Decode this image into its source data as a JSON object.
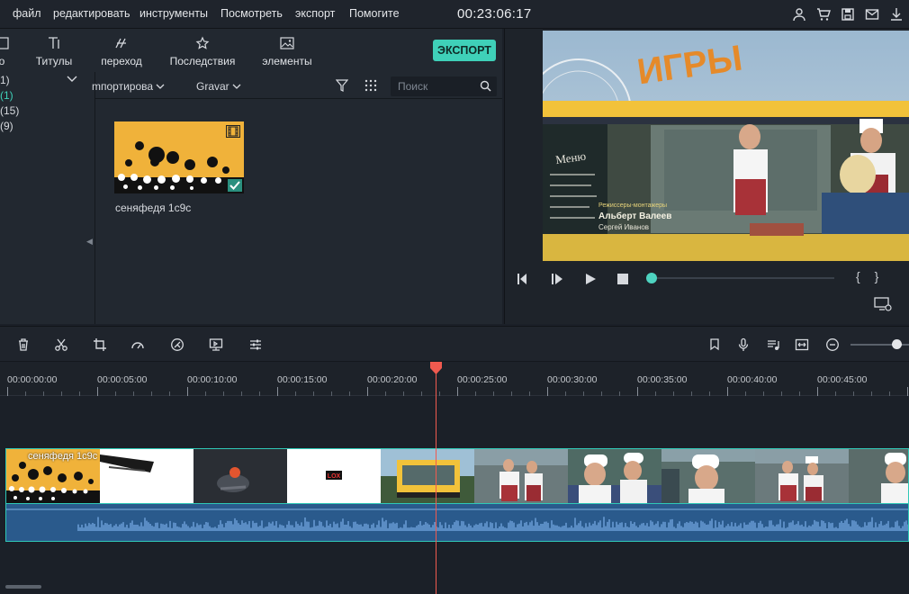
{
  "menu": {
    "items": [
      "файл",
      "редактировать",
      "инструменты",
      "Посмотреть",
      "экспорт",
      "Помогите"
    ],
    "timecode": "00:23:06:17"
  },
  "top_icons": [
    "user-icon",
    "cart-icon",
    "save-icon",
    "mail-icon",
    "download-icon"
  ],
  "library": {
    "tabs": [
      {
        "label": "о",
        "icon": "media-icon"
      },
      {
        "label": "Титулы",
        "icon": "titles-icon"
      },
      {
        "label": "переход",
        "icon": "transition-icon"
      },
      {
        "label": "Последствия",
        "icon": "effects-icon"
      },
      {
        "label": "элементы",
        "icon": "elements-icon"
      }
    ],
    "export_label": "ЭКСПОРТ",
    "sidebar": [
      {
        "label": "1)",
        "active": false
      },
      {
        "label": "(1)",
        "active": true
      },
      {
        "label": " (15)",
        "active": false
      },
      {
        "label": "(9)",
        "active": false
      }
    ],
    "filter": {
      "import_label": "mпортирова",
      "sort_label": "Gravar",
      "search_placeholder": "Поиск"
    },
    "clip": {
      "name": "сеняфедя 1с9с"
    }
  },
  "preview": {
    "overlay_line1": "Режиссеры-монтажеры",
    "overlay_line2": "Альберт Валеев",
    "overlay_line3": "Сергей Иванов",
    "sign_text": "ИГРЫ",
    "menu_board": "Меню",
    "progress": 0.0,
    "braces": "{ }"
  },
  "toolbar": {
    "left_icons": [
      "delete-icon",
      "cut-icon",
      "crop-icon",
      "speed-icon",
      "color-icon",
      "screen-icon",
      "adjust-icon"
    ],
    "right_icons": [
      "marker-icon",
      "mic-icon",
      "audio-mixer-icon",
      "fit-icon",
      "zoom-out-icon"
    ],
    "zoom_level": 0.8
  },
  "timeline": {
    "ruler": [
      "00:00:00:00",
      "00:00:05:00",
      "00:00:10:00",
      "00:00:15:00",
      "00:00:20:00",
      "00:00:25:00",
      "00:00:30:00",
      "00:00:35:00",
      "00:00:40:00",
      "00:00:45:00"
    ],
    "clip_label": "сеняфедя 1с9с",
    "logo_text": "LOX"
  },
  "colors": {
    "accent": "#3fd0b8",
    "playhead": "#f05a4f",
    "audio": "#2a5a8c",
    "thumb_yellow": "#f0b23a"
  }
}
